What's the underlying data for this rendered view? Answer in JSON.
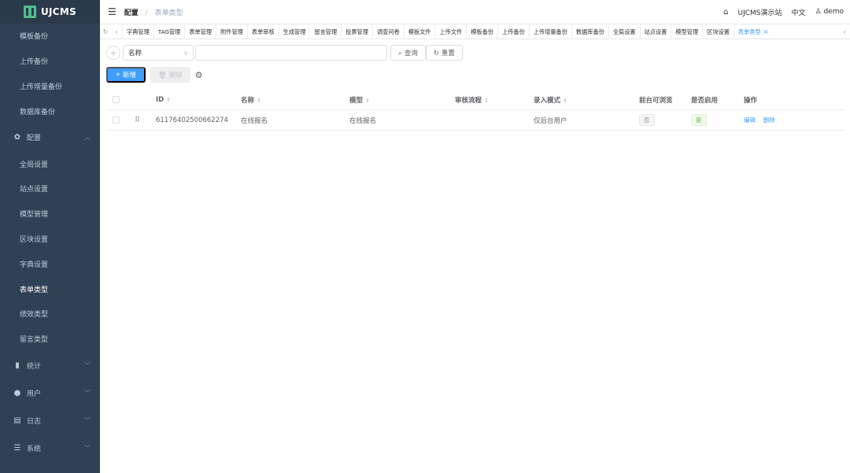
{
  "brand": {
    "name": "UJCMS"
  },
  "sidebar": {
    "top_items": [
      {
        "label": "模板备份"
      },
      {
        "label": "上传备份"
      },
      {
        "label": "上传增量备份"
      },
      {
        "label": "数据库备份"
      }
    ],
    "config_group": {
      "label": "配置",
      "icon": "gear-icon",
      "expanded": true
    },
    "config_items": [
      {
        "label": "全局设置"
      },
      {
        "label": "站点设置"
      },
      {
        "label": "模型管理"
      },
      {
        "label": "区块设置"
      },
      {
        "label": "字典设置"
      },
      {
        "label": "表单类型",
        "active": true
      },
      {
        "label": "绩效类型"
      },
      {
        "label": "留言类型"
      }
    ],
    "groups": [
      {
        "label": "统计",
        "icon": "bar-chart-icon"
      },
      {
        "label": "用户",
        "icon": "user-icon"
      },
      {
        "label": "日志",
        "icon": "clipboard-icon"
      },
      {
        "label": "系统",
        "icon": "sliders-icon"
      }
    ]
  },
  "header": {
    "breadcrumb": [
      "配置",
      "表单类型"
    ],
    "site_link": "UJCMS演示站",
    "language": "中文",
    "user": "demo"
  },
  "tabs": [
    "字典管理",
    "TAG管理",
    "表单管理",
    "附件管理",
    "表单审核",
    "生成管理",
    "留言管理",
    "投票管理",
    "调查问卷",
    "模板文件",
    "上传文件",
    "模板备份",
    "上传备份",
    "上传增量备份",
    "数据库备份",
    "全局设置",
    "站点设置",
    "模型管理",
    "区块设置",
    "表单类型"
  ],
  "active_tab": "表单类型",
  "search": {
    "field": "名称",
    "value": "",
    "query_label": "查询",
    "reset_label": "重置"
  },
  "actions": {
    "add_label": "新增",
    "delete_label": "删除"
  },
  "table": {
    "columns": [
      "ID",
      "名称",
      "模型",
      "审核流程",
      "录入模式",
      "前台可浏览",
      "是否启用",
      "操作"
    ],
    "rows": [
      {
        "id": "61176402500662274",
        "name": "在线报名",
        "model": "在线报名",
        "flow": "",
        "mode": "仅后台用户",
        "browsable": "否",
        "enabled": "是",
        "ops": [
          "编辑",
          "删除"
        ]
      }
    ]
  },
  "colors": {
    "sidebar_bg": "#304156",
    "primary": "#409eff",
    "success": "#67c23a"
  }
}
